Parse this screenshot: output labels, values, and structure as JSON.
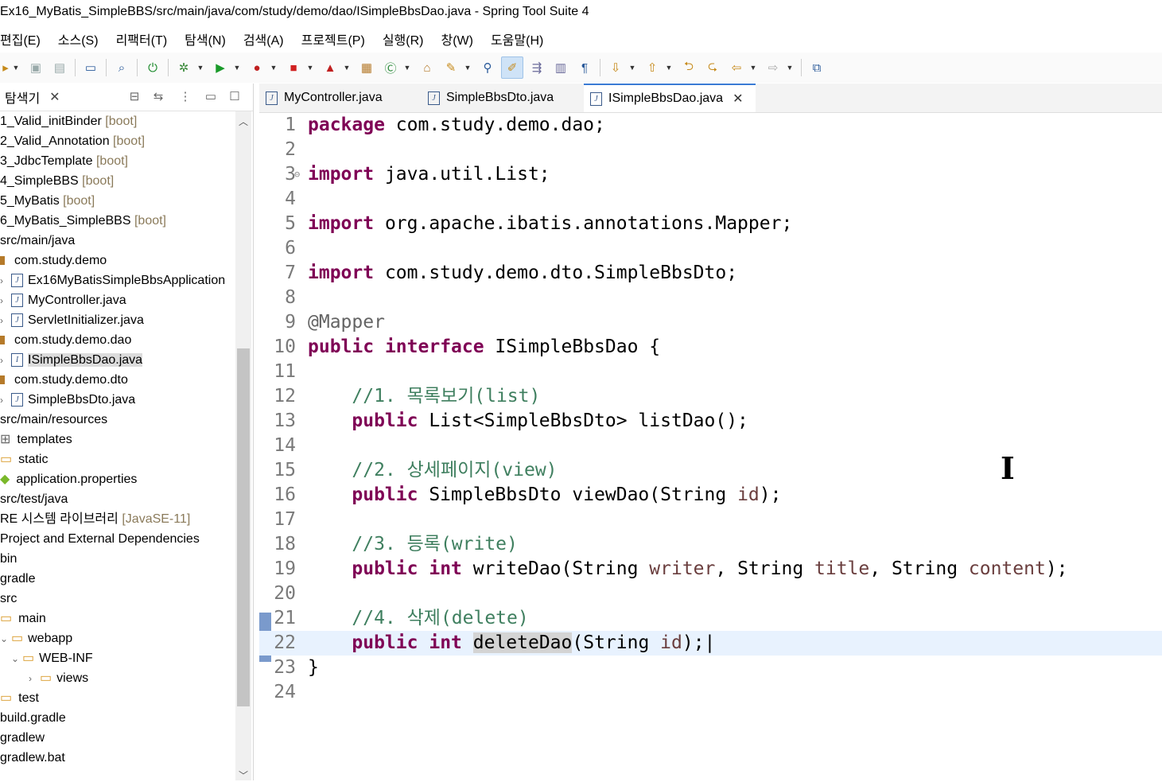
{
  "window": {
    "title": "Ex16_MyBatis_SimpleBBS/src/main/java/com/study/demo/dao/ISimpleBbsDao.java - Spring Tool Suite 4"
  },
  "menu": [
    "편집(E)",
    "소스(S)",
    "리팩터(T)",
    "탐색(N)",
    "검색(A)",
    "프로젝트(P)",
    "실행(R)",
    "창(W)",
    "도움말(H)"
  ],
  "explorer": {
    "title": "탐색기",
    "items": [
      {
        "label": "1_Valid_initBinder",
        "dec": "[boot]"
      },
      {
        "label": "2_Valid_Annotation",
        "dec": "[boot]"
      },
      {
        "label": "3_JdbcTemplate",
        "dec": "[boot]"
      },
      {
        "label": "4_SimpleBBS",
        "dec": "[boot]"
      },
      {
        "label": "5_MyBatis",
        "dec": "[boot]"
      },
      {
        "label": "6_MyBatis_SimpleBBS",
        "dec": "[boot]"
      },
      {
        "label": "src/main/java",
        "dec": ""
      },
      {
        "label": "com.study.demo",
        "dec": ""
      },
      {
        "label": "Ex16MyBatisSimpleBbsApplication",
        "dec": ""
      },
      {
        "label": "MyController.java",
        "dec": ""
      },
      {
        "label": "ServletInitializer.java",
        "dec": ""
      },
      {
        "label": "com.study.demo.dao",
        "dec": ""
      },
      {
        "label": "ISimpleBbsDao.java",
        "dec": ""
      },
      {
        "label": "com.study.demo.dto",
        "dec": ""
      },
      {
        "label": "SimpleBbsDto.java",
        "dec": ""
      },
      {
        "label": "src/main/resources",
        "dec": ""
      },
      {
        "label": "templates",
        "dec": ""
      },
      {
        "label": "static",
        "dec": ""
      },
      {
        "label": "application.properties",
        "dec": ""
      },
      {
        "label": "src/test/java",
        "dec": ""
      },
      {
        "label": "RE 시스템 라이브러리",
        "dec": "[JavaSE-11]"
      },
      {
        "label": "Project and External Dependencies",
        "dec": ""
      },
      {
        "label": "bin",
        "dec": ""
      },
      {
        "label": "gradle",
        "dec": ""
      },
      {
        "label": "src",
        "dec": ""
      },
      {
        "label": "main",
        "dec": ""
      },
      {
        "label": "webapp",
        "dec": ""
      },
      {
        "label": "WEB-INF",
        "dec": ""
      },
      {
        "label": "views",
        "dec": ""
      },
      {
        "label": "test",
        "dec": ""
      },
      {
        "label": "build.gradle",
        "dec": ""
      },
      {
        "label": "gradlew",
        "dec": ""
      },
      {
        "label": "gradlew.bat",
        "dec": ""
      }
    ]
  },
  "tabs": [
    {
      "label": "MyController.java"
    },
    {
      "label": "SimpleBbsDto.java"
    },
    {
      "label": "ISimpleBbsDao.java"
    }
  ],
  "code": {
    "l1_kw": "package",
    "l1_rest": " com.study.demo.dao;",
    "l3_kw": "import",
    "l3_rest": " java.util.List;",
    "l5_kw": "import",
    "l5_rest": " org.apache.ibatis.annotations.Mapper;",
    "l7_kw": "import",
    "l7_rest": " com.study.demo.dto.SimpleBbsDto;",
    "l9_an": "@Mapper",
    "l10_kw1": "public",
    "l10_kw2": "interface",
    "l10_rest": " ISimpleBbsDao {",
    "l12_cm": "//1. 목록보기(list)",
    "l13_kw": "public",
    "l13_rest": " List<SimpleBbsDto> listDao();",
    "l15_cm": "//2. 상세페이지(view)",
    "l16_kw": "public",
    "l16_a": " SimpleBbsDto viewDao(String ",
    "l16_p": "id",
    "l16_b": ");",
    "l18_cm": "//3. 등록(write)",
    "l19_kw1": "public",
    "l19_kw2": "int",
    "l19_a": " writeDao(String ",
    "l19_p1": "writer",
    "l19_b": ", String ",
    "l19_p2": "title",
    "l19_c": ", String ",
    "l19_p3": "content",
    "l19_d": ");",
    "l21_cm": "//4. 삭제(delete)",
    "l22_kw1": "public",
    "l22_kw2": "int",
    "l22_hl": "deleteDao",
    "l22_a": "(String ",
    "l22_p": "id",
    "l22_b": ");|",
    "l23": "}"
  }
}
